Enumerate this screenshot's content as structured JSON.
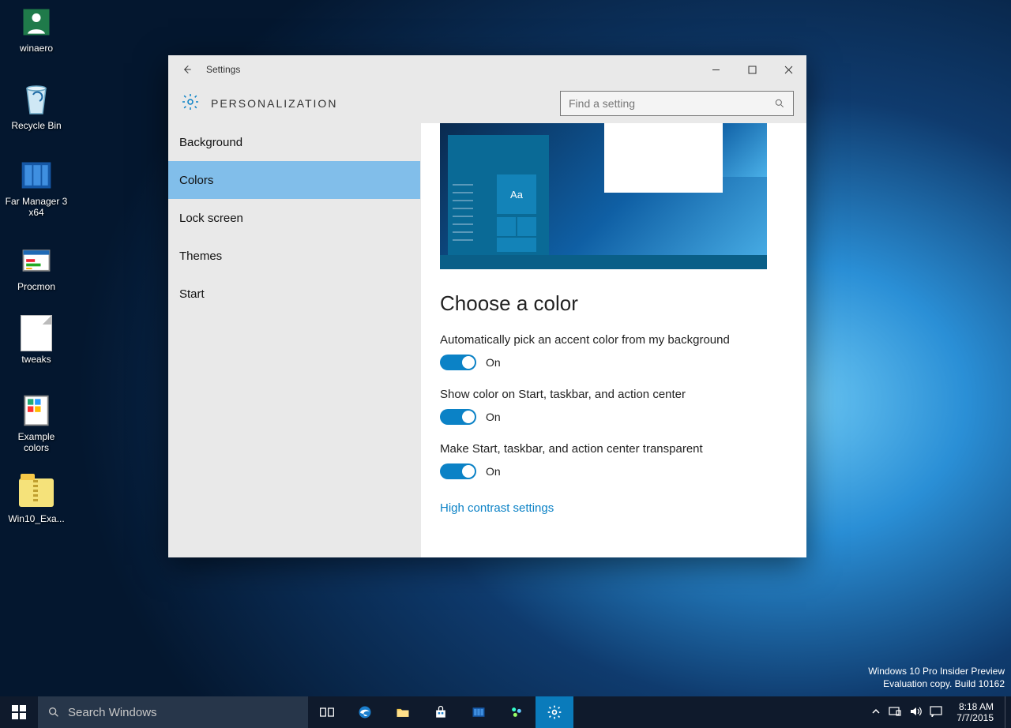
{
  "desktop_icons": [
    {
      "label": "winaero"
    },
    {
      "label": "Recycle Bin"
    },
    {
      "label": "Far Manager 3 x64"
    },
    {
      "label": "Procmon"
    },
    {
      "label": "tweaks"
    },
    {
      "label": "Example colors"
    },
    {
      "label": "Win10_Exa..."
    }
  ],
  "watermark": {
    "line1": "Windows 10 Pro Insider Preview",
    "line2": "Evaluation copy. Build 10162"
  },
  "taskbar": {
    "search_placeholder": "Search Windows",
    "tray": {
      "time": "8:18 AM",
      "date": "7/7/2015"
    }
  },
  "window": {
    "title": "Settings",
    "section": "PERSONALIZATION",
    "search_placeholder": "Find a setting",
    "sidebar": {
      "items": [
        {
          "label": "Background"
        },
        {
          "label": "Colors"
        },
        {
          "label": "Lock screen"
        },
        {
          "label": "Themes"
        },
        {
          "label": "Start"
        }
      ],
      "selected_index": 1
    },
    "content": {
      "preview_sample": "Aa",
      "heading": "Choose a color",
      "settings": [
        {
          "label": "Automatically pick an accent color from my background",
          "state": "On"
        },
        {
          "label": "Show color on Start, taskbar, and action center",
          "state": "On"
        },
        {
          "label": "Make Start, taskbar, and action center transparent",
          "state": "On"
        }
      ],
      "link": "High contrast settings"
    }
  }
}
